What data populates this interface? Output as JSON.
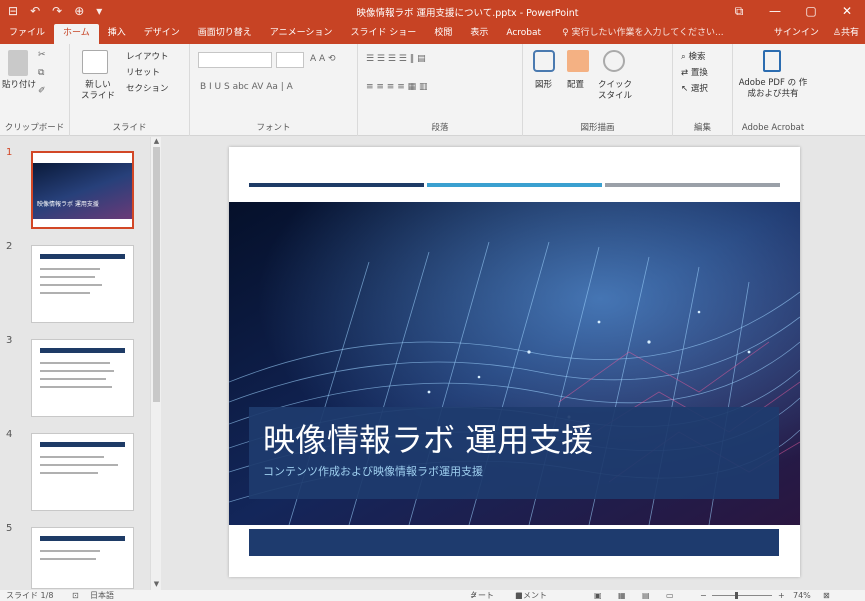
{
  "window": {
    "title": "映像情報ラボ 運用支援について.pptx - PowerPoint",
    "quick_access": [
      "⊟",
      "↶",
      "↷",
      "⊕",
      "▾"
    ],
    "controls": [
      "⧉",
      "—",
      "▢",
      "✕"
    ]
  },
  "ribbon_tabs": [
    "ファイル",
    "ホーム",
    "挿入",
    "デザイン",
    "画面切り替え",
    "アニメーション",
    "スライド ショー",
    "校閲",
    "表示",
    "Acrobat"
  ],
  "active_tab": "ホーム",
  "tell_me": "実行したい作業を入力してください...",
  "sign_in": "サインイン",
  "share": "共有",
  "ribbon": {
    "clipboard": {
      "paste": "貼り付け",
      "label": "クリップボード"
    },
    "slides": {
      "new_slide": "新しい スライド",
      "layout": "レイアウト",
      "reset": "リセット",
      "section": "セクション",
      "label": "スライド"
    },
    "font": {
      "label": "フォント",
      "row2": "B  I  U  S  abc  AV  Aa  |  A"
    },
    "paragraph": {
      "label": "段落"
    },
    "drawing": {
      "shapes": "図形",
      "arrange": "配置",
      "quick_styles": "クイック スタイル",
      "label": "図形描画"
    },
    "editing": {
      "find": "検索",
      "replace": "置換",
      "select": "選択",
      "label": "編集"
    },
    "acrobat": {
      "create": "Adobe PDF の 作成および共有",
      "label": "Adobe Acrobat"
    }
  },
  "thumbnails": [
    {
      "num": "1",
      "title": "映像情報ラボ 運用支援",
      "selected": true
    },
    {
      "num": "2",
      "title": "業務内容について",
      "selected": false
    },
    {
      "num": "3",
      "title": "業務内容",
      "selected": false
    },
    {
      "num": "4",
      "title": "業務内容",
      "selected": false
    },
    {
      "num": "5",
      "title": "業務内容",
      "selected": false
    }
  ],
  "slide": {
    "title": "映像情報ラボ 運用支援",
    "subtitle": "コンテンツ作成および映像情報ラボ運用支援"
  },
  "status": {
    "slide_count": "スライド 1/8",
    "language": "日本語",
    "notes": "ノート",
    "comments": "コメント",
    "zoom": "74%"
  }
}
